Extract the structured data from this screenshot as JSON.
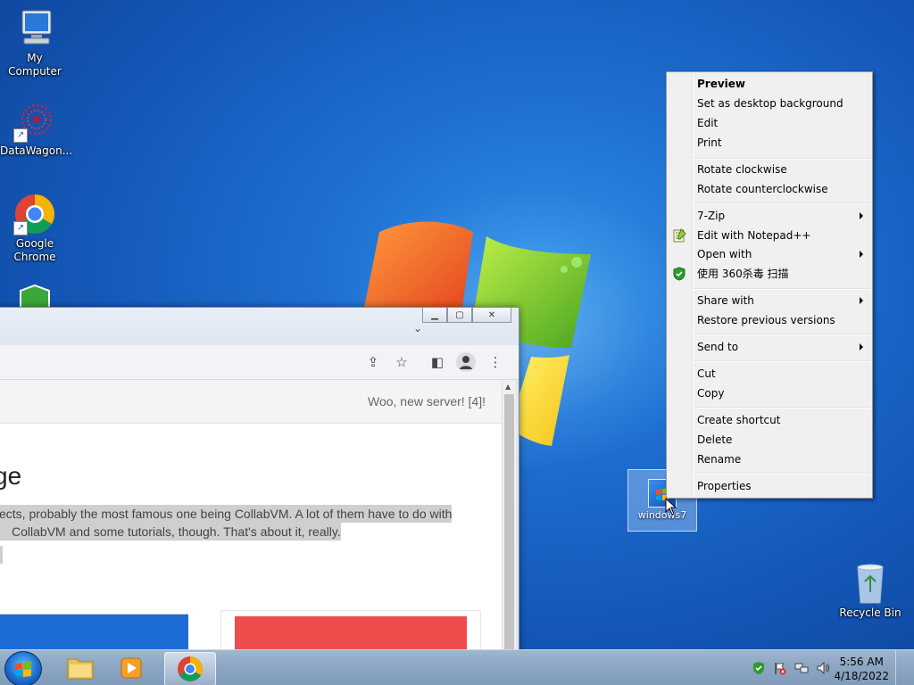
{
  "desktop": {
    "icons": [
      {
        "label": "My Computer",
        "icon": "computer-icon"
      },
      {
        "label": "DataWagon...",
        "icon": "datawagon-icon"
      },
      {
        "label": "Google Chrome",
        "icon": "chrome-icon"
      },
      {
        "label": "",
        "icon": "security-shield-icon"
      },
      {
        "label": "Recycle Bin",
        "icon": "recycle-bin-icon"
      }
    ],
    "selected_file": {
      "label": "windows7",
      "icon": "image-file-icon"
    }
  },
  "browser": {
    "notice": "Woo, new server! [4]!",
    "page_title": "ge",
    "paragraph_line1": "ects, probably the most famous one being CollabVM. A lot of them have to do with",
    "paragraph_line2": "CollabVM and some tutorials, though. That's about it, really.",
    "colors": {
      "card_blue": "#1e6cd6",
      "card_red": "#ec4c4c"
    }
  },
  "context_menu": {
    "items": [
      {
        "label": "Preview",
        "bold": true
      },
      {
        "label": "Set as desktop background"
      },
      {
        "label": "Edit"
      },
      {
        "label": "Print"
      },
      {
        "label": "Rotate clockwise"
      },
      {
        "label": "Rotate counterclockwise"
      },
      {
        "label": "7-Zip",
        "submenu": true
      },
      {
        "label": "Edit with Notepad++",
        "icon": "notepadpp-icon"
      },
      {
        "label": "Open with",
        "submenu": true
      },
      {
        "label": "使用 360杀毒 扫描",
        "icon": "shield-360-icon"
      },
      {
        "label": "Share with",
        "submenu": true
      },
      {
        "label": "Restore previous versions"
      },
      {
        "label": "Send to",
        "submenu": true
      },
      {
        "label": "Cut"
      },
      {
        "label": "Copy"
      },
      {
        "label": "Create shortcut"
      },
      {
        "label": "Delete"
      },
      {
        "label": "Rename"
      },
      {
        "label": "Properties"
      }
    ]
  },
  "taskbar": {
    "pinned": [
      {
        "name": "explorer",
        "icon": "folder-icon"
      },
      {
        "name": "media-player",
        "icon": "media-player-icon"
      },
      {
        "name": "chrome",
        "icon": "chrome-icon",
        "active": true
      }
    ],
    "tray_icons": [
      "shield-tray-icon",
      "action-center-flag-icon",
      "network-icon",
      "volume-icon"
    ],
    "clock": {
      "time": "5:56 AM",
      "date": "4/18/2022"
    }
  }
}
